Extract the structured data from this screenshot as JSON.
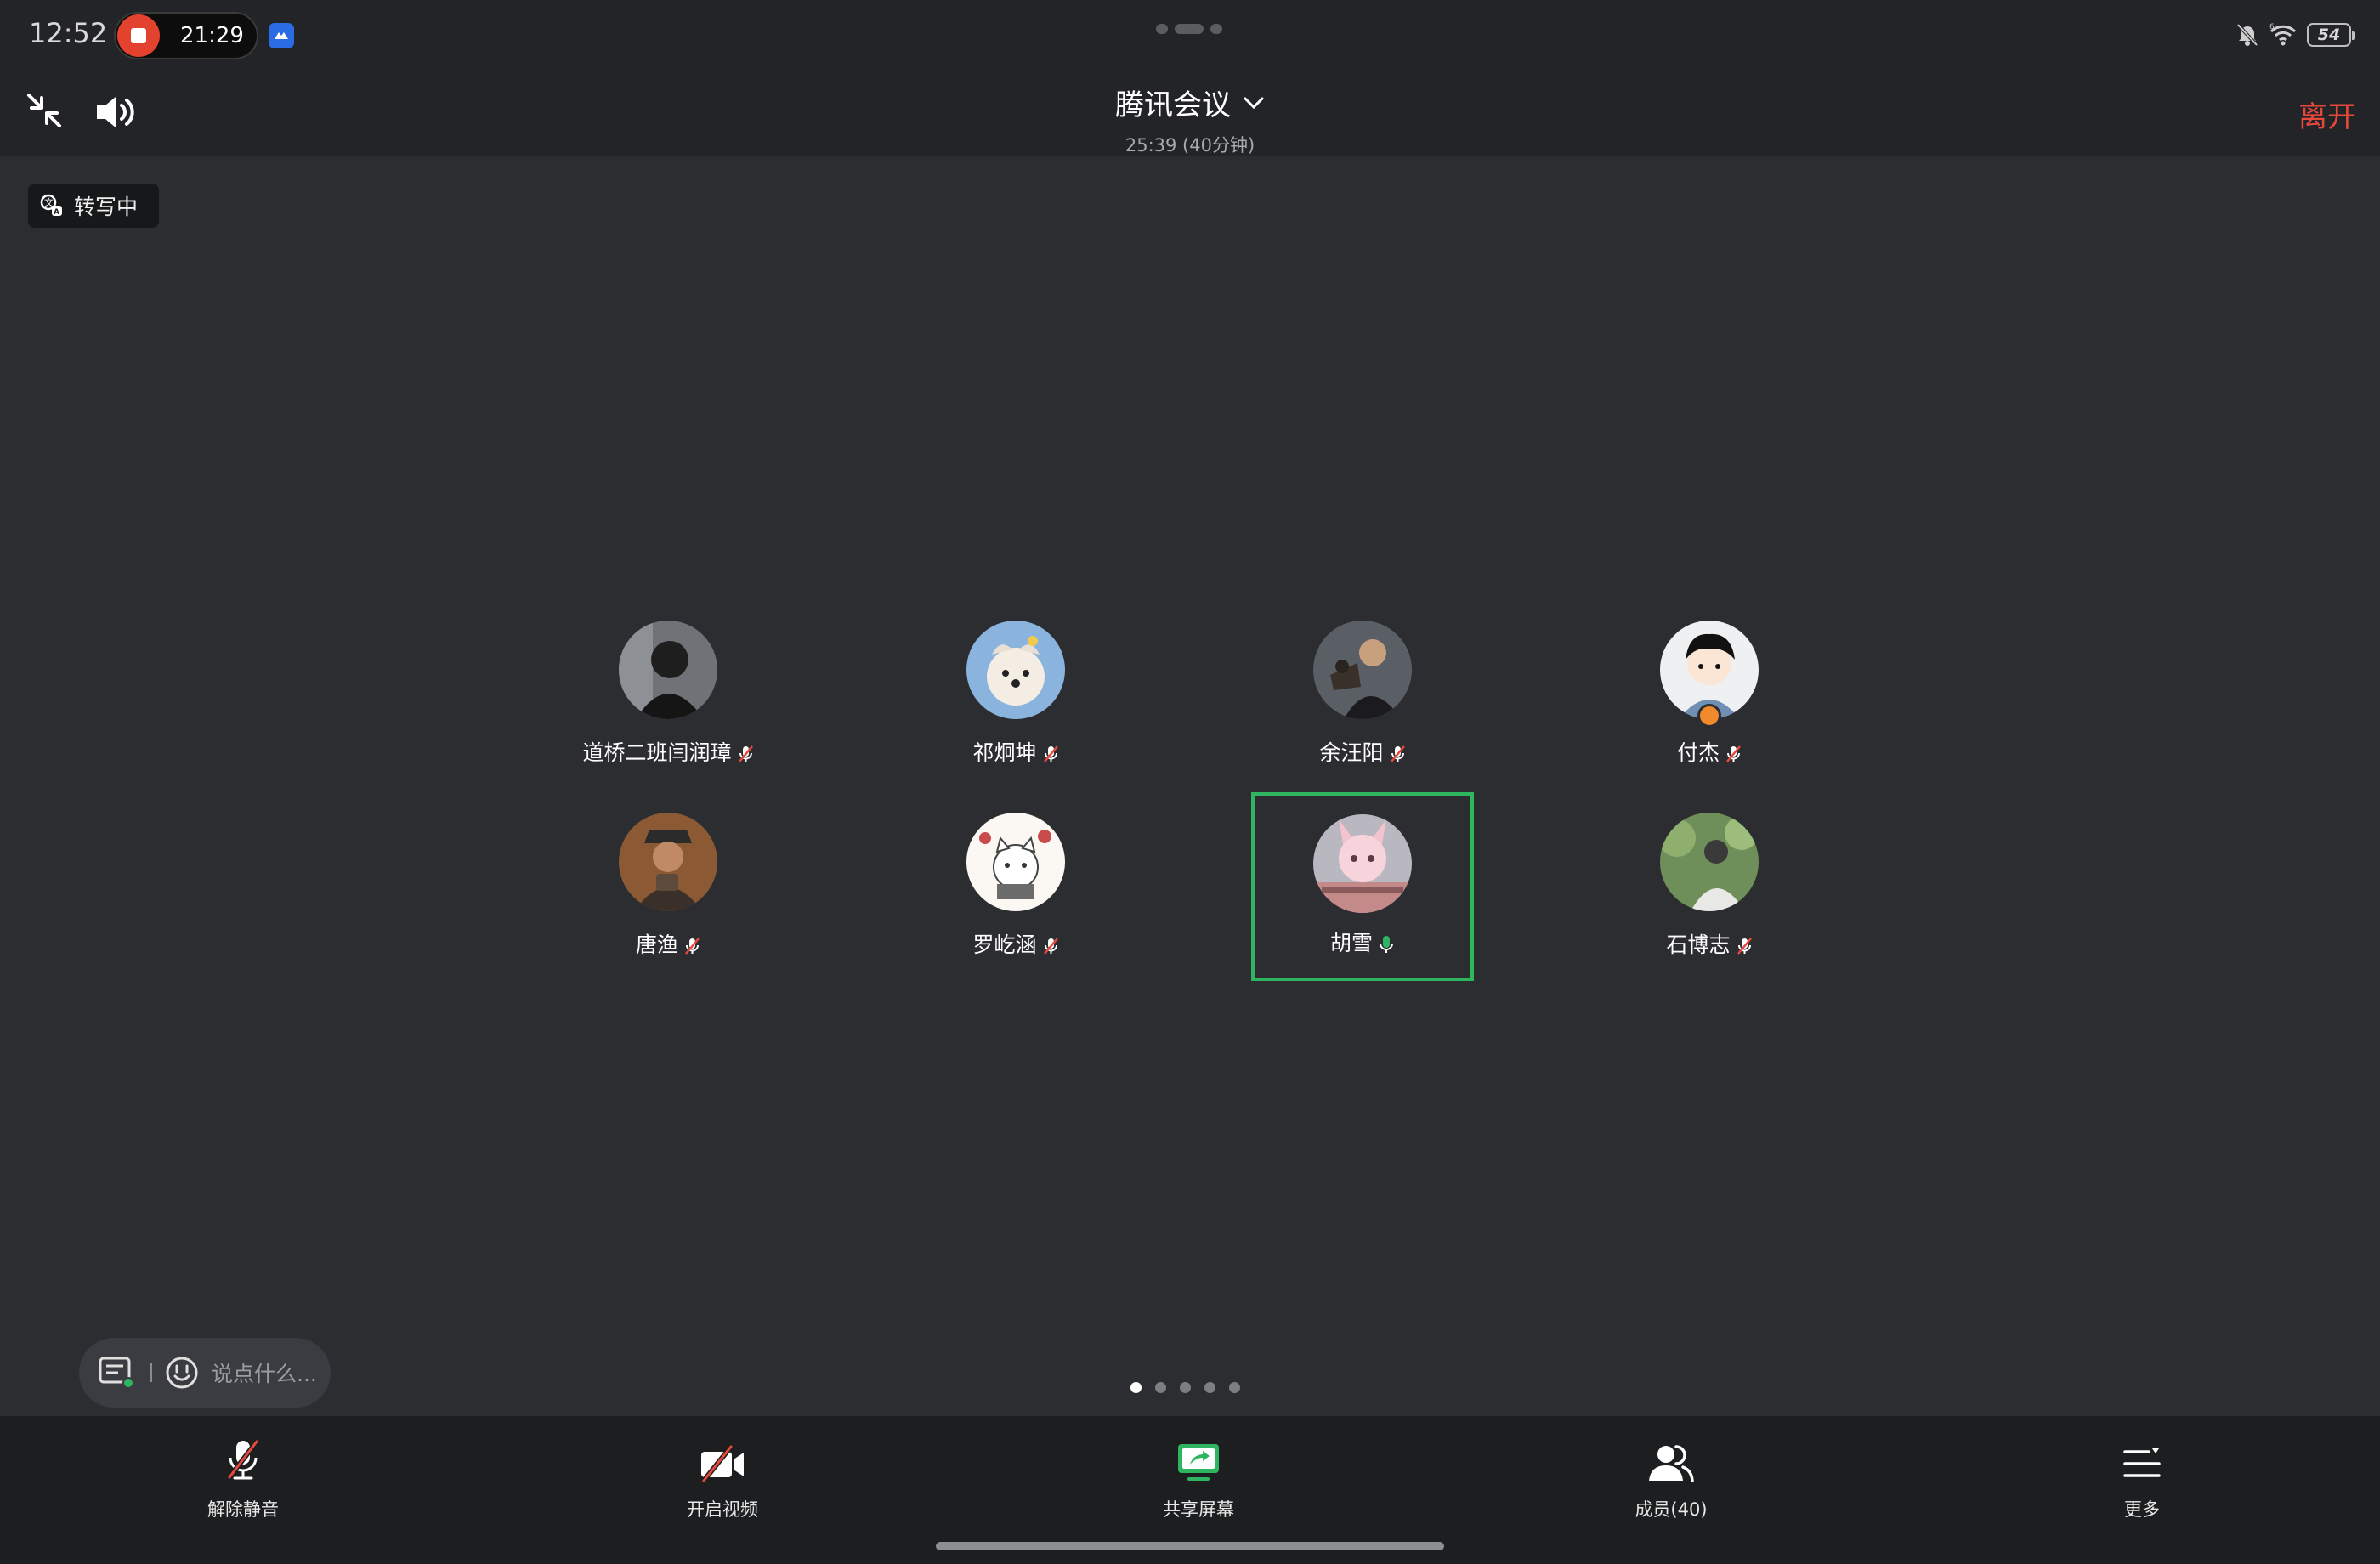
{
  "status_bar": {
    "time": "12:52",
    "recording_time": "21:29",
    "battery": "54"
  },
  "header": {
    "title": "腾讯会议",
    "subtitle": "25:39 (40分钟)",
    "leave_label": "离开"
  },
  "transcribe_badge": "转写中",
  "participants": [
    {
      "name": "道桥二班闫润璋",
      "mic": "muted"
    },
    {
      "name": "祁炯坤",
      "mic": "muted"
    },
    {
      "name": "余汪阳",
      "mic": "muted"
    },
    {
      "name": "付杰",
      "mic": "muted",
      "host": true
    },
    {
      "name": "唐渔",
      "mic": "muted"
    },
    {
      "name": "罗屹涵",
      "mic": "muted"
    },
    {
      "name": "胡雪",
      "mic": "on",
      "speaking": true
    },
    {
      "name": "石博志",
      "mic": "muted"
    }
  ],
  "chat": {
    "placeholder": "说点什么..."
  },
  "pagination": {
    "pages": 5,
    "current": 1
  },
  "toolbar": {
    "unmute": "解除静音",
    "video": "开启视频",
    "share": "共享屏幕",
    "members": "成员(40)",
    "more": "更多"
  },
  "colors": {
    "leave": "#e8483c",
    "speaking_frame": "#2fb560",
    "share_icon": "#2fb560",
    "muted_slash": "#e8483c"
  }
}
